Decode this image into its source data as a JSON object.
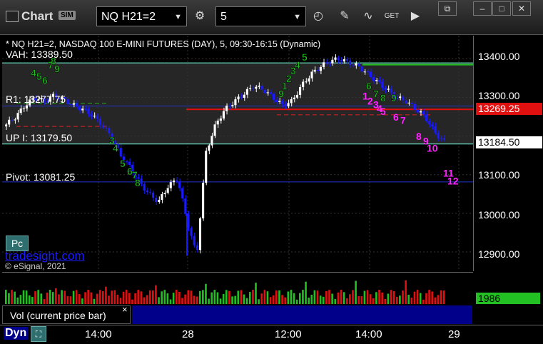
{
  "toolbar": {
    "app_title": "Chart",
    "sim_badge": "SIM",
    "symbol": "NQ H21=2",
    "interval": "5",
    "buttons": [
      "gear-icon",
      "clock-icon",
      "pencil-icon",
      "study-icon",
      "get-icon",
      "play-icon"
    ],
    "get_label": "GET"
  },
  "chart": {
    "header": "* NQ H21=2, NASDAQ 100 E-MINI FUTURES (DAY), 5, 09:30-16:15 (Dynamic)",
    "levels": {
      "vah": "VAH: 13389.50",
      "r1": "R1: 13277.75",
      "up": "UP I: 13179.50",
      "pivot": "Pivot: 13081.25"
    },
    "watermark": "tradesight.com",
    "copyright": "© eSignal, 2021",
    "pc_button": "Pc",
    "price_tag_red": "13269.25",
    "price_tag_current": "13184.50",
    "colors": {
      "up": "#ffffff",
      "down": "#1a1aff",
      "green_count": "#22c022",
      "magenta_count": "#ff22ff"
    }
  },
  "chart_data": {
    "type": "candlestick",
    "title": "* NQ H21=2, NASDAQ 100 E-MINI FUTURES (DAY), 5, 09:30-16:15 (Dynamic)",
    "ylim": [
      12850,
      13460
    ],
    "yticks": [
      "13400.00",
      "13300.00",
      "13200.00",
      "13100.00",
      "13000.00",
      "12900.00"
    ],
    "xticks": [
      "14:00",
      "28",
      "12:00",
      "14:00",
      "29"
    ],
    "levels": [
      {
        "name": "VAH",
        "value": 13389.5
      },
      {
        "name": "R1",
        "value": 13277.75
      },
      {
        "name": "UP I",
        "value": 13179.5
      },
      {
        "name": "Pivot",
        "value": 13081.25
      }
    ],
    "approx_close_path": [
      13230,
      13250,
      13280,
      13300,
      13290,
      13305,
      13295,
      13280,
      13270,
      13255,
      13230,
      13200,
      13150,
      13120,
      13080,
      13050,
      13030,
      13070,
      13090,
      12980,
      12890,
      13160,
      13230,
      13270,
      13290,
      13310,
      13330,
      13320,
      13300,
      13280,
      13290,
      13330,
      13360,
      13380,
      13395,
      13400,
      13390,
      13380,
      13360,
      13340,
      13320,
      13300,
      13290,
      13270,
      13250,
      13210,
      13185
    ],
    "volume_last": "1986",
    "counts_green": [
      "4",
      "5",
      "6",
      "7",
      "8",
      "9",
      "3",
      "4",
      "5",
      "6",
      "7",
      "8",
      "9",
      "1",
      "2",
      "3",
      "4",
      "5",
      "6",
      "7",
      "8",
      "9"
    ],
    "counts_magenta": [
      "1",
      "2",
      "3",
      "4",
      "5",
      "6",
      "7",
      "8",
      "9",
      "10",
      "11",
      "12"
    ]
  },
  "volume": {
    "label": "Vol (current price bar)",
    "close": "×",
    "value": "1986"
  },
  "footer": {
    "dyn": "Dyn",
    "x_labels": [
      "14:00",
      "28",
      "12:00",
      "14:00",
      "29"
    ]
  }
}
